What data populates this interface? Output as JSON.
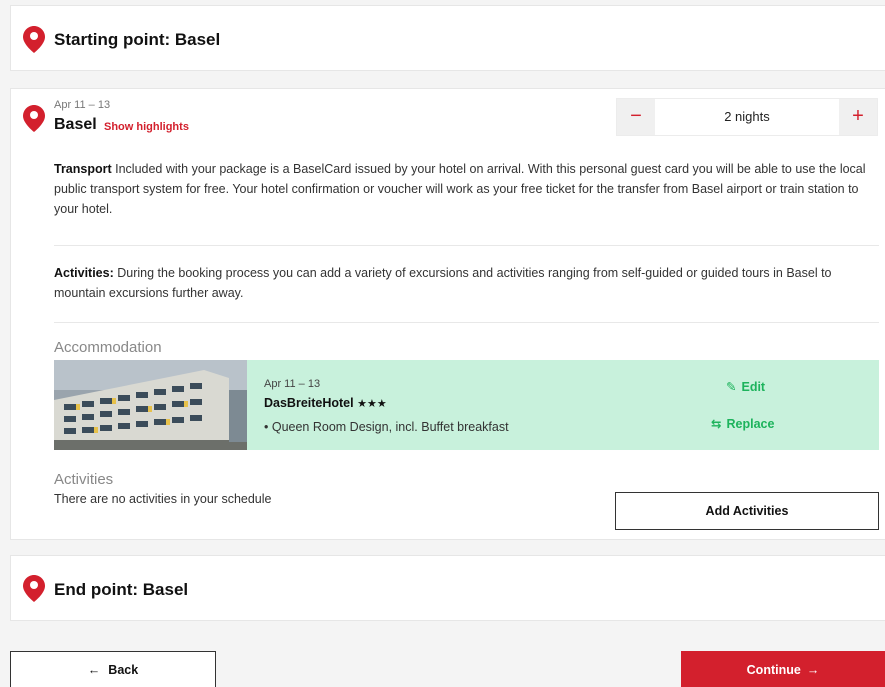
{
  "start": {
    "title": "Starting point: Basel"
  },
  "stop": {
    "date": "Apr 11 – 13",
    "city": "Basel",
    "highlights_link": "Show highlights",
    "nights_value": "2 nights",
    "minus_symbol": "−",
    "plus_symbol": "+",
    "transport_label": "Transport",
    "transport_text": " Included with your package is a BaselCard issued by your hotel on arrival. With this personal guest card you will be able to use the local public transport system for free. Your hotel confirmation or voucher will work as your free ticket for the transfer from Basel airport or train station to your hotel.",
    "activities_label": "Activities:",
    "activities_text": " During the booking process you can add a variety of excursions and activities ranging from self-guided or guided tours in Basel to mountain excursions further away."
  },
  "accommodation": {
    "heading": "Accommodation",
    "date": "Apr 11 – 13",
    "hotel_name": "DasBreiteHotel",
    "stars": "★★★",
    "room": "• Queen Room Design, incl. Buffet breakfast",
    "edit_label": "Edit",
    "replace_label": "Replace"
  },
  "activities": {
    "heading": "Activities",
    "empty_text": "There are no activities in your schedule",
    "add_button": "Add Activities"
  },
  "end": {
    "title": "End point: Basel"
  },
  "footer": {
    "back_label": "Back",
    "continue_label": "Continue"
  },
  "colors": {
    "accent": "#d3202d",
    "green": "#1db35c",
    "hotel_bg": "#c8f1dc"
  }
}
